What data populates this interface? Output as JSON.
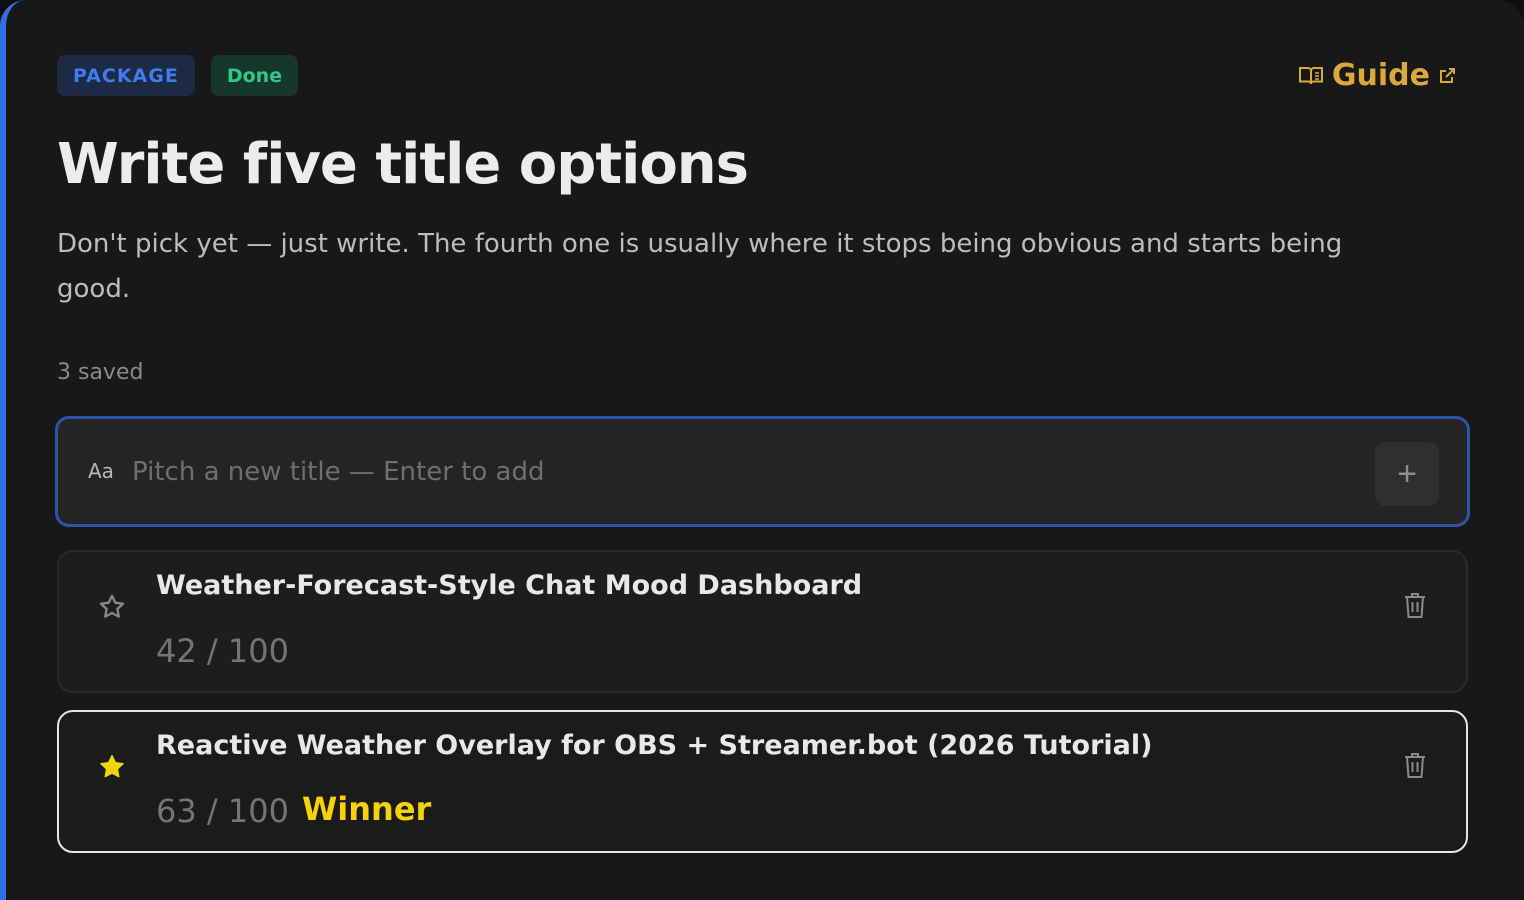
{
  "header": {
    "badge_type": "PACKAGE",
    "badge_status": "Done",
    "guide_label": "Guide"
  },
  "task": {
    "title": "Write five title options",
    "description": "Don't pick yet — just write. The fourth one is usually where it stops being obvious and starts being good.",
    "saved_count": "3 saved"
  },
  "composer": {
    "aa_label": "Aa",
    "placeholder": "Pitch a new title — Enter to add",
    "value": "",
    "add_icon": "plus-icon"
  },
  "titles": [
    {
      "title": "Weather-Forecast-Style Chat Mood Dashboard",
      "score": "42 / 100",
      "starred": false,
      "winner_label": ""
    },
    {
      "title": "Reactive Weather Overlay for OBS + Streamer.bot (2026 Tutorial)",
      "score": "63 / 100",
      "starred": true,
      "winner_label": "Winner"
    }
  ],
  "colors": {
    "accent_blue": "#2f6fe0",
    "badge_green": "#35c58e",
    "guide_gold": "#d9a93a",
    "winner_yellow": "#f5d20b"
  }
}
